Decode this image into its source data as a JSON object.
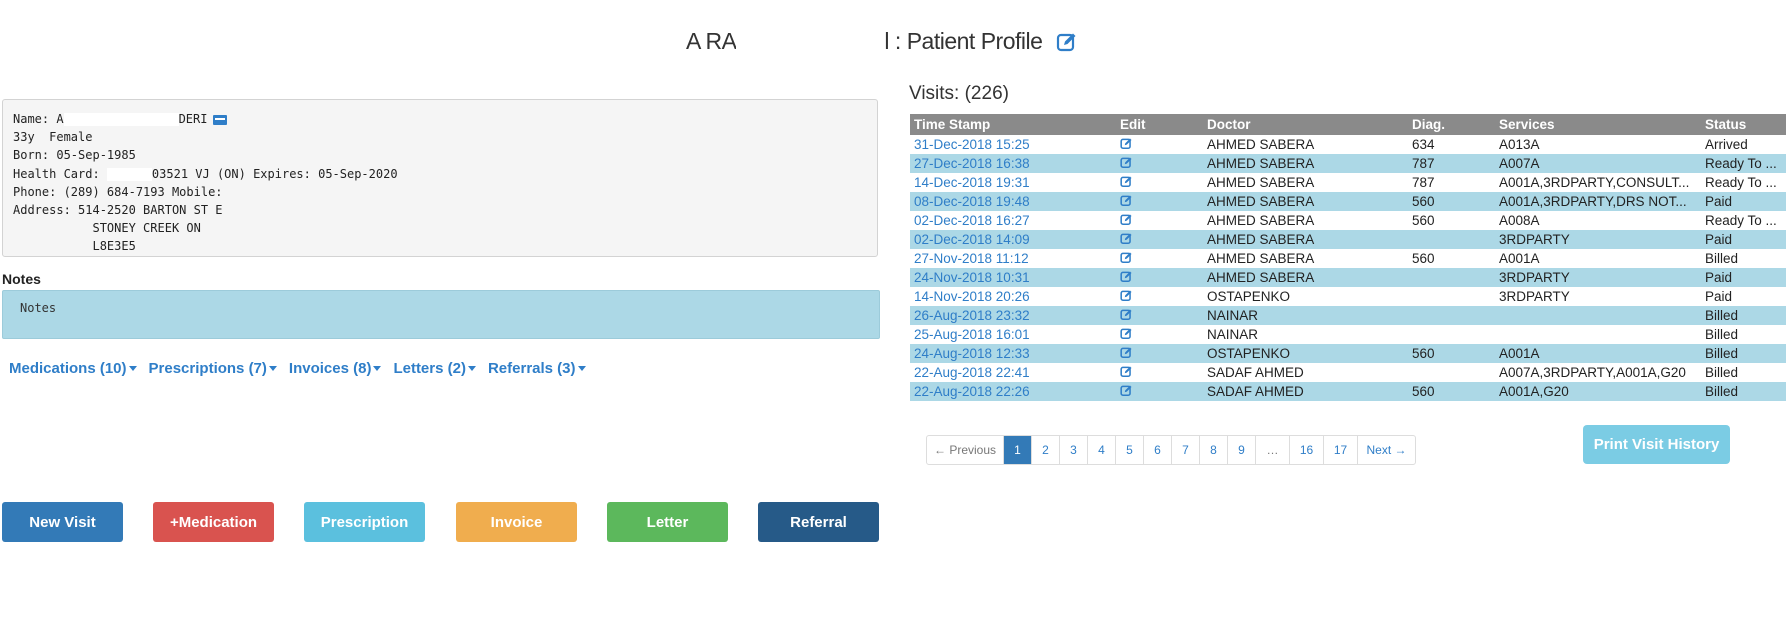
{
  "title": {
    "prefix": "A RA",
    "suffix": "l : Patient Profile"
  },
  "patient": {
    "name_label": "Name: A",
    "name_suffix": "DERI",
    "age_sex": "33y  Female",
    "born": "Born: 05-Sep-1985",
    "health_card_label": "Health Card: ",
    "health_card_suffix": "03521 VJ (ON) Expires: 05-Sep-2020",
    "phone": "Phone: (289) 684-7193 Mobile:",
    "address_line1": "Address: 514-2520 BARTON ST E",
    "address_line2": "           STONEY CREEK ON",
    "address_line3": "           L8E3E5"
  },
  "notes": {
    "label": "Notes",
    "placeholder": "Notes"
  },
  "tabs": [
    {
      "label": "Medications (10)"
    },
    {
      "label": "Prescriptions (7)"
    },
    {
      "label": "Invoices (8)"
    },
    {
      "label": "Letters (2)"
    },
    {
      "label": "Referrals (3)"
    }
  ],
  "actions": {
    "new_visit": "New Visit",
    "medication": "+Medication",
    "prescription": "Prescription",
    "invoice": "Invoice",
    "letter": "Letter",
    "referral": "Referral"
  },
  "visits": {
    "title": "Visits: (226)",
    "headers": [
      "Time Stamp",
      "Edit",
      "Doctor",
      "Diag.",
      "Services",
      "Status"
    ],
    "rows": [
      {
        "ts": "31-Dec-2018 15:25",
        "doctor": "AHMED SABERA",
        "diag": "634",
        "services": "A013A",
        "status": "Arrived"
      },
      {
        "ts": "27-Dec-2018 16:38",
        "doctor": "AHMED SABERA",
        "diag": "787",
        "services": "A007A",
        "status": "Ready To ..."
      },
      {
        "ts": "14-Dec-2018 19:31",
        "doctor": "AHMED SABERA",
        "diag": "787",
        "services": "A001A,3RDPARTY,CONSULT...",
        "status": "Ready To ..."
      },
      {
        "ts": "08-Dec-2018 19:48",
        "doctor": "AHMED SABERA",
        "diag": "560",
        "services": "A001A,3RDPARTY,DRS NOT...",
        "status": "Paid"
      },
      {
        "ts": "02-Dec-2018 16:27",
        "doctor": "AHMED SABERA",
        "diag": "560",
        "services": "A008A",
        "status": "Ready To ..."
      },
      {
        "ts": "02-Dec-2018 14:09",
        "doctor": "AHMED SABERA",
        "diag": "",
        "services": "3RDPARTY",
        "status": "Paid"
      },
      {
        "ts": "27-Nov-2018 11:12",
        "doctor": "AHMED SABERA",
        "diag": "560",
        "services": "A001A",
        "status": "Billed"
      },
      {
        "ts": "24-Nov-2018 10:31",
        "doctor": "AHMED SABERA",
        "diag": "",
        "services": "3RDPARTY",
        "status": "Paid"
      },
      {
        "ts": "14-Nov-2018 20:26",
        "doctor": "OSTAPENKO",
        "diag": "",
        "services": "3RDPARTY",
        "status": "Paid"
      },
      {
        "ts": "26-Aug-2018 23:32",
        "doctor": "NAINAR",
        "diag": "",
        "services": "",
        "status": "Billed"
      },
      {
        "ts": "25-Aug-2018 16:01",
        "doctor": "NAINAR",
        "diag": "",
        "services": "",
        "status": "Billed"
      },
      {
        "ts": "24-Aug-2018 12:33",
        "doctor": "OSTAPENKO",
        "diag": "560",
        "services": "A001A",
        "status": "Billed"
      },
      {
        "ts": "22-Aug-2018 22:41",
        "doctor": "SADAF AHMED",
        "diag": "",
        "services": "A007A,3RDPARTY,A001A,G20",
        "status": "Billed"
      },
      {
        "ts": "22-Aug-2018 22:26",
        "doctor": "SADAF AHMED",
        "diag": "560",
        "services": "A001A,G20",
        "status": "Billed"
      }
    ]
  },
  "pagination": [
    "← Previous",
    "1",
    "2",
    "3",
    "4",
    "5",
    "6",
    "7",
    "8",
    "9",
    "…",
    "16",
    "17",
    "Next →"
  ],
  "print_button": "Print Visit History",
  "colors": {
    "link": "#2f7ec8",
    "row_alt": "#acd8e6",
    "header": "#8a8a8a",
    "new_visit": "#337ab7",
    "medication": "#d9534f",
    "prescription": "#5bc0de",
    "invoice": "#f0ad4e",
    "letter": "#5cb85c",
    "referral": "#265a88"
  }
}
